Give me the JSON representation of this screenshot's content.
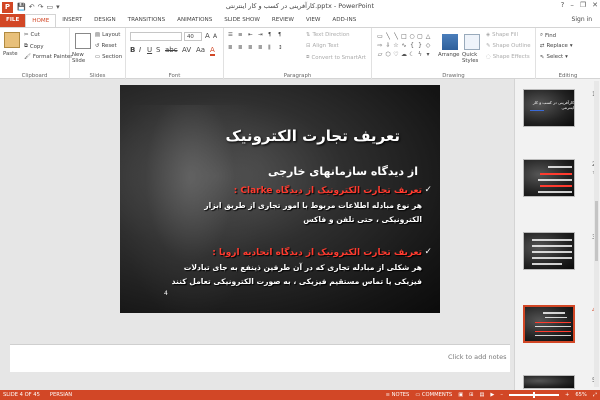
{
  "window": {
    "title": "کارآفرینی در کسب و کار اینترنتی.pptx - PowerPoint",
    "app_icon": "P",
    "sign_in": "Sign in",
    "controls": [
      "?",
      "–",
      "❐",
      "✕"
    ]
  },
  "tabs": [
    "FILE",
    "HOME",
    "INSERT",
    "DESIGN",
    "TRANSITIONS",
    "ANIMATIONS",
    "SLIDE SHOW",
    "REVIEW",
    "VIEW",
    "ADD-INS"
  ],
  "ribbon": {
    "clipboard": {
      "label": "Clipboard",
      "paste": "Paste",
      "cut": "Cut",
      "copy": "Copy",
      "format_painter": "Format Painter"
    },
    "slides": {
      "label": "Slides",
      "new_slide": "New Slide",
      "layout": "Layout",
      "reset": "Reset",
      "section": "Section"
    },
    "font": {
      "label": "Font",
      "size": "40"
    },
    "paragraph": {
      "label": "Paragraph",
      "text_direction": "Text Direction",
      "align_text": "Align Text",
      "convert": "Convert to SmartArt"
    },
    "drawing": {
      "label": "Drawing",
      "arrange": "Arrange",
      "quick_styles": "Quick Styles",
      "shape_fill": "Shape Fill",
      "shape_outline": "Shape Outline",
      "shape_effects": "Shape Effects"
    },
    "editing": {
      "label": "Editing",
      "find": "Find",
      "replace": "Replace",
      "select": "Select"
    }
  },
  "slide": {
    "title": "تعریف تجارت الکترونیک",
    "subtitle": "از دیدگاه سازمانهای خارجی",
    "point1_heading": "تعریف تجارت الکترونیک از دیدگاه Clarke :",
    "point1_line1": "هر نوع مبادله اطلاعات مربوط با امور تجاری از طریق ابزار",
    "point1_line2": "الکترونیکی ، حتی تلفن و فاکس",
    "point2_heading": "تعریف تجارت الکترونیک از دیدگاه اتحادیه اروپا :",
    "point2_line1": "هر شکلی از مبادله تجاری که در آن طرفین ذینفع به جای تبادلات",
    "point2_line2": "فیزیکی یا تماس مستقیم فیزیکی ، به صورت الکترونیکی تعامل کنند",
    "number": "4",
    "check": "✓"
  },
  "notes": {
    "placeholder": "Click to add notes"
  },
  "thumbnails": [
    {
      "num": "1",
      "title": "کارآفرینی در کسب و کار اینترنتی"
    },
    {
      "num": "2",
      "star": "★"
    },
    {
      "num": "3"
    },
    {
      "num": "4",
      "selected": true
    },
    {
      "num": "5"
    }
  ],
  "status": {
    "slide_info": "SLIDE 4 OF 45",
    "language": "PERSIAN",
    "notes": "NOTES",
    "comments": "COMMENTS",
    "zoom": "65%"
  },
  "colors": {
    "accent": "#d24726",
    "slide_red": "#ff3b2f"
  }
}
